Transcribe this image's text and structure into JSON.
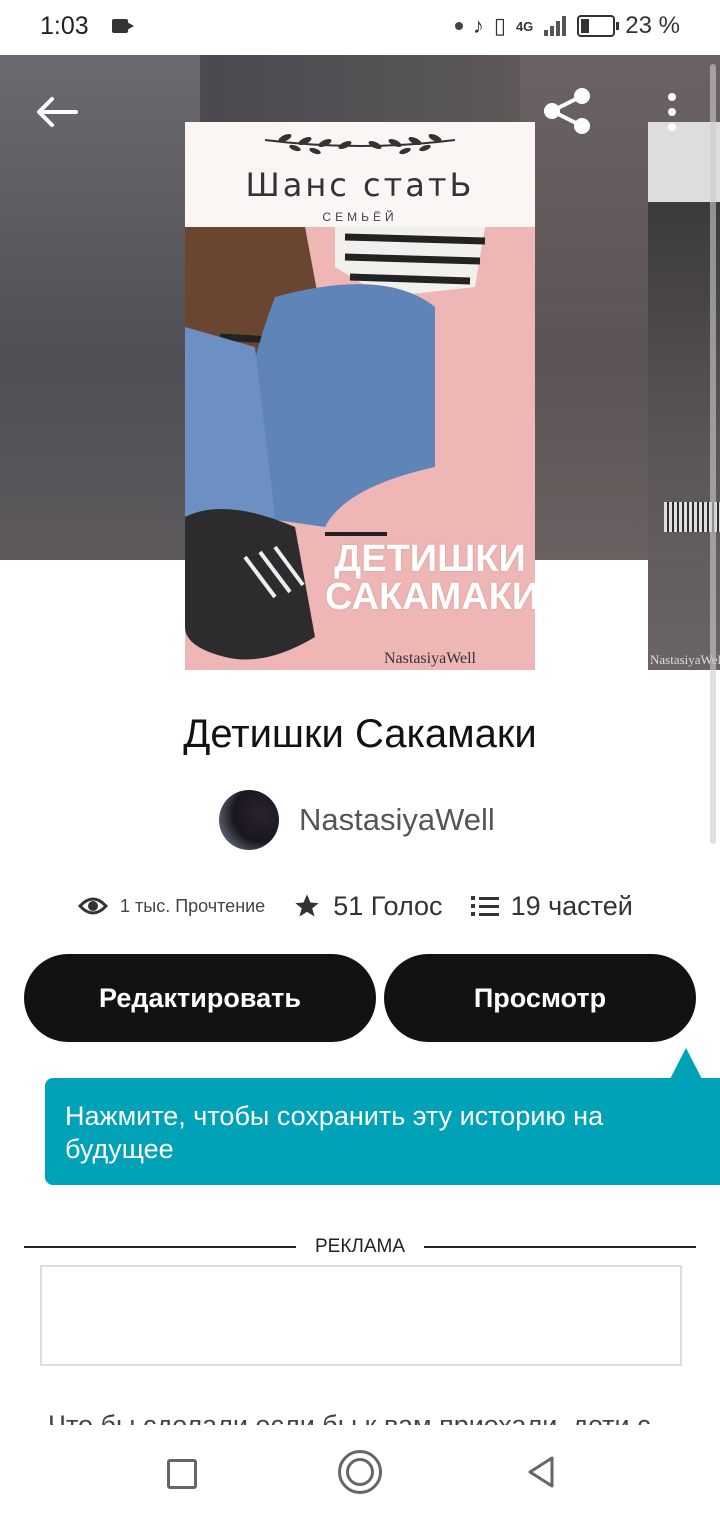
{
  "status_bar": {
    "time": "1:03",
    "network": "4G",
    "battery_percent": "23 %"
  },
  "header": {
    "back_icon": "arrow-left-icon",
    "share_icon": "share-icon",
    "more_icon": "more-vertical-icon"
  },
  "cover": {
    "title": "Шанс статЬ",
    "subtitle": "СЕМЬЁЙ",
    "big_title": "ДЕТИШКИ САКАМАКИ",
    "author": "NastasiyaWell"
  },
  "next_cover": {
    "author": "NastasiyaWell"
  },
  "book": {
    "title": "Детишки Сакамаки",
    "author": "NastasiyaWell"
  },
  "stats": {
    "reads": "1 тыс. Прочтение",
    "votes": "51 Голос",
    "parts": "19 частей"
  },
  "actions": {
    "edit": "Редактировать",
    "view": "Просмотр"
  },
  "tooltip": {
    "text": "Нажмите, чтобы сохранить эту историю на будущее"
  },
  "ad": {
    "label": "РЕКЛАМА"
  },
  "description": {
    "text": "Что бы сделали если бы к вам приехали, дети с..."
  },
  "colors": {
    "accent": "#00a2b8",
    "button_bg": "#121212"
  }
}
